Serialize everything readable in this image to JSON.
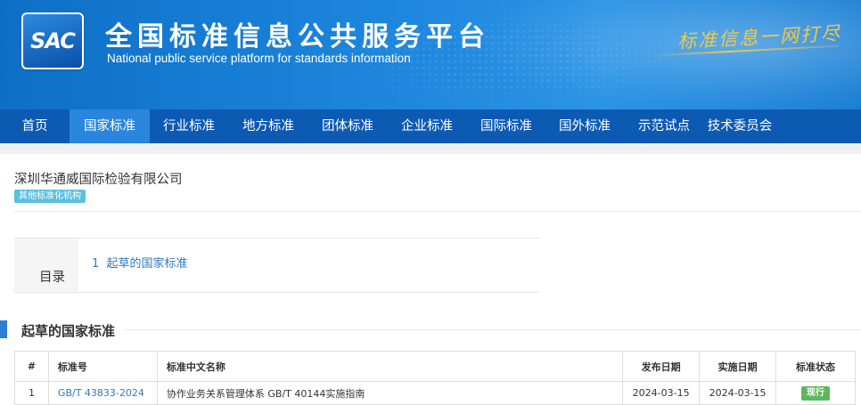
{
  "header": {
    "logo_text": "SAC",
    "title": "全国标准信息公共服务平台",
    "subtitle": "National public service platform  for standards information",
    "slogan": "标准信息一网打尽"
  },
  "nav": {
    "items": [
      {
        "label": "首页"
      },
      {
        "label": "国家标准"
      },
      {
        "label": "行业标准"
      },
      {
        "label": "地方标准"
      },
      {
        "label": "团体标准"
      },
      {
        "label": "企业标准"
      },
      {
        "label": "国际标准"
      },
      {
        "label": "国外标准"
      },
      {
        "label": "示范试点"
      },
      {
        "label": "技术委员会"
      }
    ],
    "active": "国家标准"
  },
  "org": {
    "name": "深圳华通威国际检验有限公司",
    "badge": "其他标准化机构"
  },
  "toc": {
    "label": "目录",
    "items": [
      {
        "num": "1",
        "text": "起草的国家标准"
      }
    ]
  },
  "section": {
    "title": "起草的国家标准"
  },
  "table": {
    "headers": [
      "#",
      "标准号",
      "标准中文名称",
      "发布日期",
      "实施日期",
      "标准状态"
    ],
    "rows": [
      {
        "index": "1",
        "code": "GB/T 43833-2024",
        "name": "协作业务关系管理体系 GB/T 40144实施指南",
        "publish_date": "2024-03-15",
        "implement_date": "2024-03-15",
        "status": "现行"
      }
    ]
  },
  "colors": {
    "header_blue": "#1d86dd",
    "nav_blue": "#0d5ab3",
    "nav_active": "#2a85dc",
    "badge_cyan": "#5bc0de",
    "link_blue": "#337ab7",
    "status_green": "#5cb85c",
    "slogan_gold": "#f0c84a"
  }
}
